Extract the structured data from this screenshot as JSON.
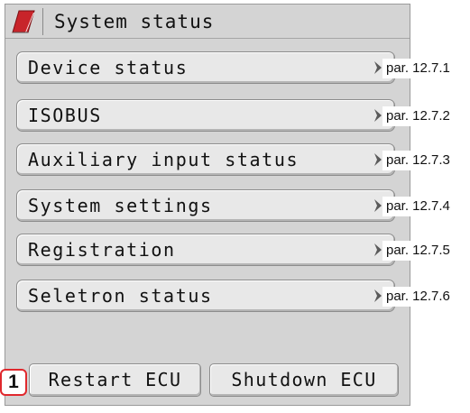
{
  "header": {
    "title": "System status",
    "logo_icon": "brand-logo-icon"
  },
  "menu": [
    {
      "label": "Device status",
      "ref": "par. 12.7.1"
    },
    {
      "label": "ISOBUS",
      "ref": "par. 12.7.2"
    },
    {
      "label": "Auxiliary input status",
      "ref": "par. 12.7.3"
    },
    {
      "label": "System settings",
      "ref": "par. 12.7.4"
    },
    {
      "label": "Registration",
      "ref": "par. 12.7.5"
    },
    {
      "label": "Seletron status",
      "ref": "par. 12.7.6"
    }
  ],
  "footer": {
    "restart_label": "Restart ECU",
    "shutdown_label": "Shutdown ECU",
    "callout_number": "1"
  },
  "colors": {
    "panel_bg": "#d4d4d4",
    "button_bg": "#e8e8e8",
    "logo_red": "#c8242a",
    "callout_border": "#e0282d"
  }
}
